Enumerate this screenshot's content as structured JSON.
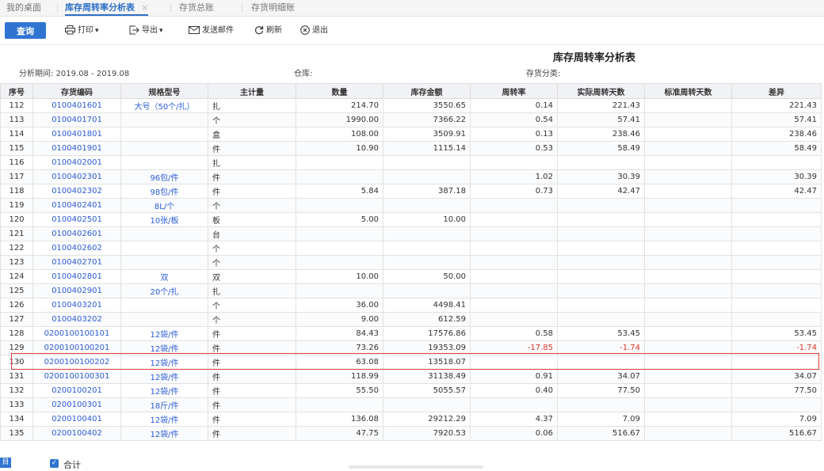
{
  "tabs": [
    {
      "label": "我的桌面"
    },
    {
      "label": "库存周转率分析表",
      "close": "×"
    },
    {
      "label": "存货总账"
    },
    {
      "label": "存货明细账"
    }
  ],
  "toolbar": {
    "query": "查询",
    "print": "打印",
    "export": "导出",
    "email": "发送邮件",
    "refresh": "刷新",
    "exit": "退出"
  },
  "report": {
    "title": "库存周转率分析表",
    "period_label": "分析期间:",
    "period_value": "2019.08 - 2019.08",
    "warehouse_label": "仓库:",
    "category_label": "存货分类:"
  },
  "table": {
    "headers": [
      "序号",
      "存货编码",
      "规格型号",
      "主计量",
      "数量",
      "库存金额",
      "周转率",
      "实际周转天数",
      "标准周转天数",
      "差异"
    ],
    "rows": [
      [
        "112",
        "0100401601",
        "大号（50个/扎）",
        "扎",
        "214.70",
        "3550.65",
        "0.14",
        "221.43",
        "",
        "221.43"
      ],
      [
        "113",
        "0100401701",
        "",
        "个",
        "1990.00",
        "7366.22",
        "0.54",
        "57.41",
        "",
        "57.41"
      ],
      [
        "114",
        "0100401801",
        "",
        "盒",
        "108.00",
        "3509.91",
        "0.13",
        "238.46",
        "",
        "238.46"
      ],
      [
        "115",
        "0100401901",
        "",
        "件",
        "10.90",
        "1115.14",
        "0.53",
        "58.49",
        "",
        "58.49"
      ],
      [
        "116",
        "0100402001",
        "",
        "扎",
        "",
        "",
        "",
        "",
        "",
        ""
      ],
      [
        "117",
        "0100402301",
        "96包/件",
        "件",
        "",
        "",
        "1.02",
        "30.39",
        "",
        "30.39"
      ],
      [
        "118",
        "0100402302",
        "98包/件",
        "件",
        "5.84",
        "387.18",
        "0.73",
        "42.47",
        "",
        "42.47"
      ],
      [
        "119",
        "0100402401",
        "8L/个",
        "个",
        "",
        "",
        "",
        "",
        "",
        ""
      ],
      [
        "120",
        "0100402501",
        "10张/板",
        "板",
        "5.00",
        "10.00",
        "",
        "",
        "",
        ""
      ],
      [
        "121",
        "0100402601",
        "",
        "台",
        "",
        "",
        "",
        "",
        "",
        ""
      ],
      [
        "122",
        "0100402602",
        "",
        "个",
        "",
        "",
        "",
        "",
        "",
        ""
      ],
      [
        "123",
        "0100402701",
        "",
        "个",
        "",
        "",
        "",
        "",
        "",
        ""
      ],
      [
        "124",
        "0100402801",
        "双",
        "双",
        "10.00",
        "50.00",
        "",
        "",
        "",
        ""
      ],
      [
        "125",
        "0100402901",
        "20个/扎",
        "扎",
        "",
        "",
        "",
        "",
        "",
        ""
      ],
      [
        "126",
        "0100403201",
        "",
        "个",
        "36.00",
        "4498.41",
        "",
        "",
        "",
        ""
      ],
      [
        "127",
        "0100403202",
        "",
        "个",
        "9.00",
        "612.59",
        "",
        "",
        "",
        ""
      ],
      [
        "128",
        "0200100100101",
        "12袋/件",
        "件",
        "84.43",
        "17576.86",
        "0.58",
        "53.45",
        "",
        "53.45"
      ],
      [
        "129",
        "0200100100201",
        "12袋/件",
        "件",
        "73.26",
        "19353.09",
        "-17.85",
        "-1.74",
        "",
        "-1.74"
      ],
      [
        "130",
        "0200100100202",
        "12袋/件",
        "件",
        "63.08",
        "13518.07",
        "",
        "",
        "",
        ""
      ],
      [
        "131",
        "0200100100301",
        "12袋/件",
        "件",
        "118.99",
        "31138.49",
        "0.91",
        "34.07",
        "",
        "34.07"
      ],
      [
        "132",
        "0200100201",
        "12袋/件",
        "件",
        "55.50",
        "5055.57",
        "0.40",
        "77.50",
        "",
        "77.50"
      ],
      [
        "133",
        "0200100301",
        "18斤/件",
        "件",
        "",
        "",
        "",
        "",
        "",
        ""
      ],
      [
        "134",
        "0200100401",
        "12袋/件",
        "件",
        "136.08",
        "29212.29",
        "4.37",
        "7.09",
        "",
        "7.09"
      ],
      [
        "135",
        "0200100402",
        "12袋/件",
        "件",
        "47.75",
        "7920.53",
        "0.06",
        "516.67",
        "",
        "516.67"
      ]
    ]
  },
  "footer": {
    "sum_label": "合计",
    "icon_glyph": "目"
  },
  "colors": {
    "accent": "#2f74d1",
    "link": "#2a5bd7",
    "negative": "#e0352b",
    "highlight_border": "#e03a3a"
  }
}
